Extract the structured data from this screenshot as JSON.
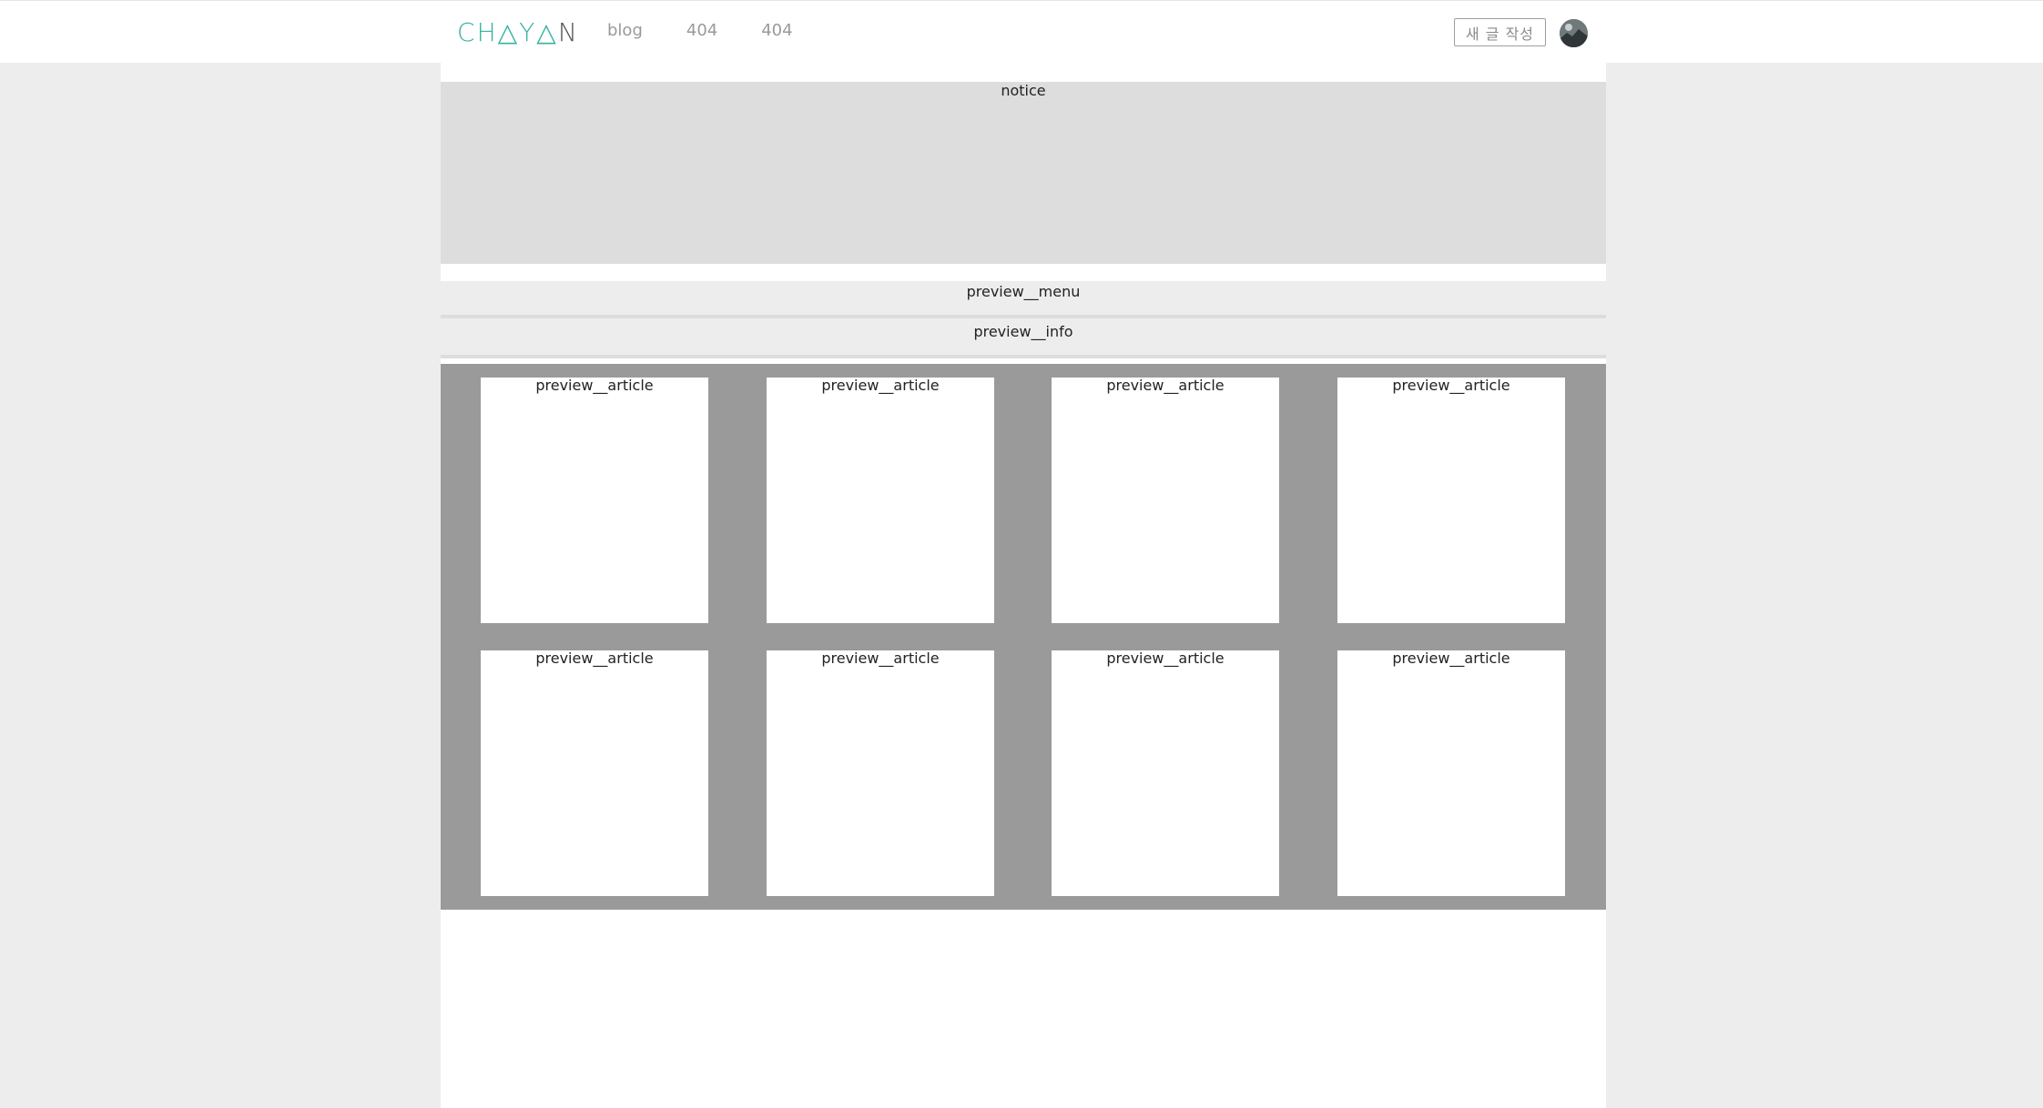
{
  "header": {
    "logo_text": "CHAYAN",
    "nav": [
      "blog",
      "404",
      "404"
    ],
    "write_label": "새 글 작성"
  },
  "main": {
    "notice": "notice",
    "preview_menu": "preview__menu",
    "preview_info": "preview__info",
    "articles": [
      "preview__article",
      "preview__article",
      "preview__article",
      "preview__article",
      "preview__article",
      "preview__article",
      "preview__article",
      "preview__article"
    ]
  },
  "colors": {
    "brand_teal": "#34b3a0",
    "page_bg": "#ededed",
    "notice_bg": "#dddddd",
    "articles_bg": "#9a9a9a"
  },
  "icons": {
    "avatar": "user-avatar-image"
  }
}
